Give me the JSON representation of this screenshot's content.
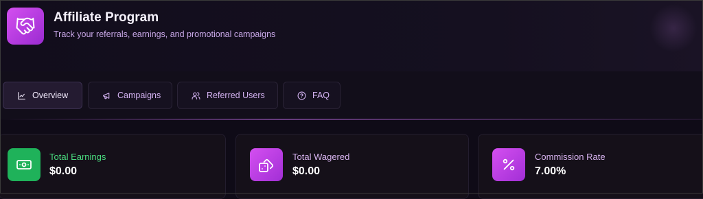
{
  "header": {
    "title": "Affiliate Program",
    "subtitle": "Track your referrals, earnings, and promotional campaigns",
    "logo_icon": "handshake-icon"
  },
  "tabs": [
    {
      "label": "Overview",
      "icon": "chart-line-icon",
      "active": true
    },
    {
      "label": "Campaigns",
      "icon": "megaphone-icon",
      "active": false
    },
    {
      "label": "Referred Users",
      "icon": "users-icon",
      "active": false
    },
    {
      "label": "FAQ",
      "icon": "question-circle-icon",
      "active": false
    }
  ],
  "stats": [
    {
      "label": "Total Earnings",
      "value": "$0.00",
      "icon": "cash-icon",
      "color": "#22c55e",
      "label_color": "#4ade80"
    },
    {
      "label": "Total Wagered",
      "value": "$0.00",
      "icon": "dice-icon",
      "color": "#c548e6",
      "label_color": "#d8b4f0"
    },
    {
      "label": "Commission Rate",
      "value": "7.00%",
      "icon": "percent-icon",
      "color": "#c548e6",
      "label_color": "#d8b4f0"
    }
  ]
}
